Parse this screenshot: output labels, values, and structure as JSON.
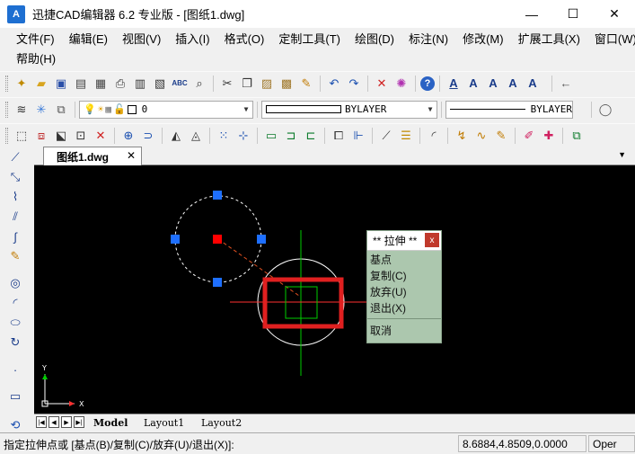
{
  "window": {
    "logo_text": "A",
    "title": "迅捷CAD编辑器 6.2 专业版  - [图纸1.dwg]",
    "minimize": "—",
    "maximize": "☐",
    "close": "✕"
  },
  "menu": {
    "row1": [
      "文件(F)",
      "编辑(E)",
      "视图(V)",
      "插入(I)",
      "格式(O)",
      "定制工具(T)",
      "绘图(D)",
      "标注(N)",
      "修改(M)",
      "扩展工具(X)",
      "窗口(W)"
    ],
    "row2": [
      "帮助(H)"
    ]
  },
  "toolbar_layer": {
    "layer_value": "0",
    "linetype_value": "BYLAYER",
    "lineweight_value": "BYLAYER"
  },
  "document_tab": {
    "label": "图纸1.dwg",
    "close": "✕"
  },
  "context_menu": {
    "title": "** 拉伸 **",
    "close": "x",
    "items": [
      "基点",
      "复制(C)",
      "放弃(U)",
      "退出(X)"
    ],
    "cancel": "取消"
  },
  "ucs": {
    "x_label": "X",
    "y_label": "Y"
  },
  "layout_tabs": [
    "Model",
    "Layout1",
    "Layout2"
  ],
  "status": {
    "prompt": "指定拉伸点或 [基点(B)/复制(C)/放弃(U)/退出(X)]:",
    "coords": "8.6884,4.8509,0.0000",
    "mode": "Oper"
  },
  "colors": {
    "canvas": "#000000",
    "grip_blue": "#1e6fff",
    "grip_hot": "#ff0000",
    "highlight_box": "#e02020",
    "crosshair": "#00cc00",
    "menu_bg": "#acc7ae"
  }
}
